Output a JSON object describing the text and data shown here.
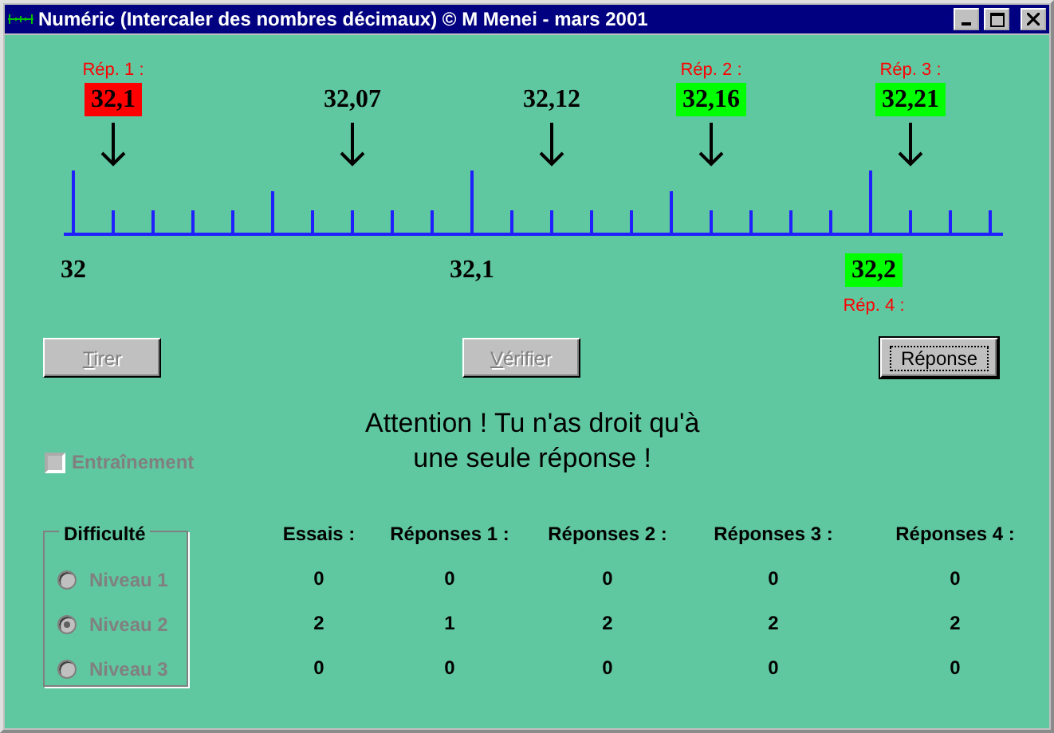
{
  "window": {
    "title": "Numéric (Intercaler des nombres décimaux) © M Menei - mars 2001"
  },
  "number_line": {
    "proposals": [
      {
        "label": "Rép. 1 :",
        "value": "32,1",
        "color": "#ff0000"
      },
      {
        "value": "32,07"
      },
      {
        "value": "32,12"
      },
      {
        "label": "Rép. 2 :",
        "value": "32,16",
        "color": "#00ff00"
      },
      {
        "label": "Rép. 3 :",
        "value": "32,21",
        "color": "#00ff00"
      }
    ],
    "graduations": [
      {
        "value": "32"
      },
      {
        "value": "32,1"
      },
      {
        "value": "32,2",
        "color": "#00ff00",
        "label": "Rép. 4 :"
      }
    ]
  },
  "buttons": [
    {
      "label": "Tirer",
      "disabled": true,
      "mnemonic": true,
      "focused": false
    },
    {
      "label": "Vérifier",
      "disabled": true,
      "mnemonic": true,
      "focused": false
    },
    {
      "label": "Réponse",
      "disabled": false,
      "mnemonic": false,
      "focused": true
    }
  ],
  "checkbox": {
    "label": "Entraînement",
    "checked": false,
    "disabled": true
  },
  "message": [
    "Attention ! Tu n'as droit qu'à",
    "une seule réponse !"
  ],
  "difficulty": {
    "title": "Difficulté",
    "options": [
      {
        "label": "Niveau 1",
        "selected": false,
        "disabled": true
      },
      {
        "label": "Niveau 2",
        "selected": true,
        "disabled": true
      },
      {
        "label": "Niveau 3",
        "selected": false,
        "disabled": true
      }
    ]
  },
  "stats": {
    "columns": [
      "Essais :",
      "Réponses 1 :",
      "Réponses 2 :",
      "Réponses 3 :",
      "Réponses 4 :"
    ],
    "rows": [
      [
        "0",
        "0",
        "0",
        "0",
        "0"
      ],
      [
        "2",
        "1",
        "2",
        "2",
        "2"
      ],
      [
        "0",
        "0",
        "0",
        "0",
        "0"
      ]
    ]
  }
}
